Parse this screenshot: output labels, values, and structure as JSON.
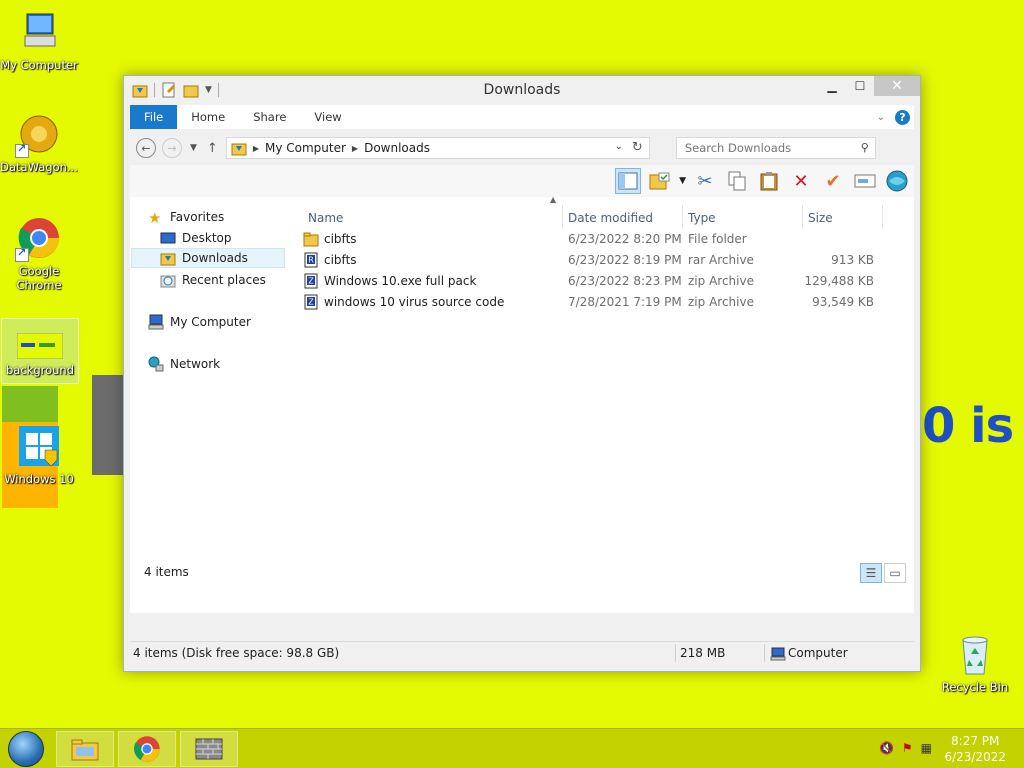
{
  "desktop": {
    "icons": [
      {
        "label": "My Computer"
      },
      {
        "label": "DataWagon..."
      },
      {
        "label": "Google Chrome"
      },
      {
        "label": "background"
      },
      {
        "label": "Windows 10"
      },
      {
        "label": "Recycle Bin"
      }
    ],
    "wallpaper_text": "0 is $"
  },
  "window": {
    "title": "Downloads",
    "ribbon_tabs": [
      "File",
      "Home",
      "Share",
      "View"
    ],
    "address": {
      "crumbs": [
        "My Computer",
        "Downloads"
      ]
    },
    "search": {
      "placeholder": "Search Downloads"
    },
    "nav": {
      "favorites": "Favorites",
      "desktop": "Desktop",
      "downloads": "Downloads",
      "recent": "Recent places",
      "computer": "My Computer",
      "network": "Network"
    },
    "columns": {
      "name": "Name",
      "date": "Date modified",
      "type": "Type",
      "size": "Size"
    },
    "files": [
      {
        "name": "cibfts",
        "date": "6/23/2022 8:20 PM",
        "type": "File folder",
        "size": "",
        "icon": "folder-icon"
      },
      {
        "name": "cibfts",
        "date": "6/23/2022 8:19 PM",
        "type": "rar Archive",
        "size": "913 KB",
        "icon": "rar-archive-icon"
      },
      {
        "name": "Windows 10.exe full pack",
        "date": "6/23/2022 8:23 PM",
        "type": "zip Archive",
        "size": "129,488 KB",
        "icon": "zip-archive-icon"
      },
      {
        "name": "windows 10 virus source code",
        "date": "7/28/2021 7:19 PM",
        "type": "zip Archive",
        "size": "93,549 KB",
        "icon": "zip-archive-icon"
      }
    ],
    "item_count": "4 items",
    "status": {
      "left": "4 items (Disk free space: 98.8 GB)",
      "size": "218 MB",
      "location": "Computer"
    }
  },
  "taskbar": {
    "time": "8:27 PM",
    "date": "6/23/2022"
  },
  "colors": {
    "desktop_bg": "#e4fa03",
    "taskbar": "#c3d200",
    "accent": "#1979ca"
  }
}
